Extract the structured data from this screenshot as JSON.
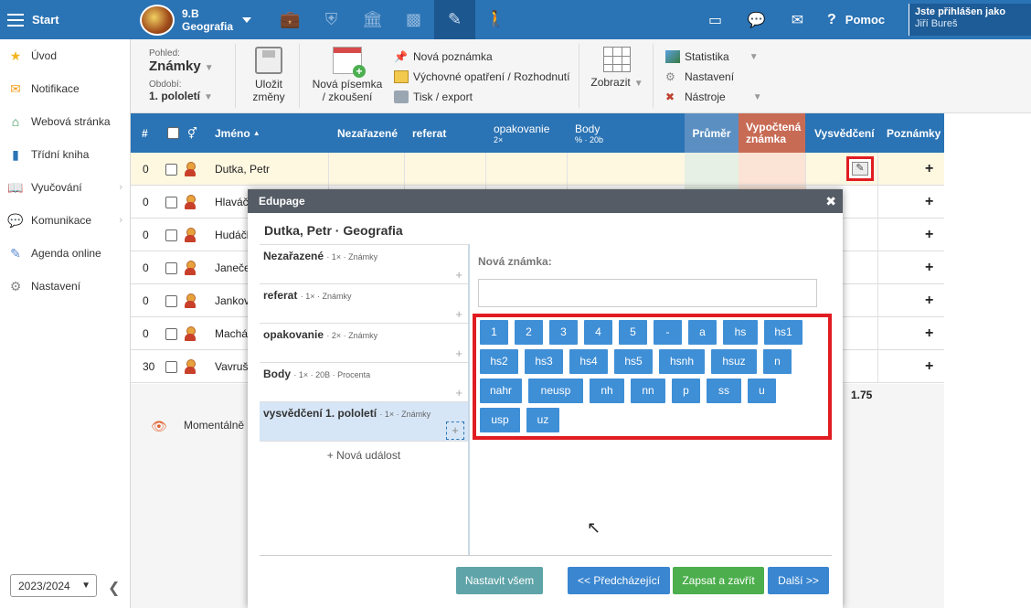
{
  "topbar": {
    "start_label": "Start",
    "class_line1": "9.B",
    "class_line2": "Geografia",
    "help_label": "Pomoc",
    "user_line1": "Jste přihlášen jako",
    "user_line2": "Jiří Bureš"
  },
  "sidebar": {
    "items": [
      {
        "label": "Úvod",
        "icon": "star-icon",
        "color": "#f2b51f"
      },
      {
        "label": "Notifikace",
        "icon": "envelope-icon",
        "color": "#f2a01f"
      },
      {
        "label": "Webová stránka",
        "icon": "home-icon",
        "color": "#2f8f4e"
      },
      {
        "label": "Třídní kniha",
        "icon": "book-icon",
        "color": "#2a73b4"
      },
      {
        "label": "Vyučování",
        "icon": "open-book-icon",
        "color": "#2a73b4"
      },
      {
        "label": "Komunikace",
        "icon": "chat-icon",
        "color": "#d04a2a"
      },
      {
        "label": "Agenda online",
        "icon": "pencil-icon",
        "color": "#5a8ad0"
      },
      {
        "label": "Nastavení",
        "icon": "gear-icon",
        "color": "#888888"
      }
    ],
    "year": "2023/2024"
  },
  "toolbar": {
    "view_label": "Pohled:",
    "view_value": "Známky",
    "period_label": "Období:",
    "period_value": "1. pololetí",
    "save_line1": "Uložit",
    "save_line2": "změny",
    "new_exam_line1": "Nová písemka",
    "new_exam_line2": "/ zkoušení",
    "list1": [
      "Nová poznámka",
      "Výchovné opatření / Rozhodnutí",
      "Tisk / export"
    ],
    "show_label": "Zobrazit",
    "list2": [
      "Statistika",
      "Nastavení",
      "Nástroje"
    ]
  },
  "table": {
    "headers": {
      "num": "#",
      "name": "Jméno",
      "nezarazene": "Nezařazené",
      "referat": "referat",
      "opakovanie": "opakovanie",
      "opakovanie_sub": "2×",
      "body": "Body",
      "body_sub": "% · 20b",
      "prumer": "Průměr",
      "vyp1": "Vypočtená",
      "vyp2": "známka",
      "vysvedceni": "Vysvědčení",
      "poznamky": "Poznámky"
    },
    "rows": [
      {
        "num": "0",
        "name": "Dutka, Petr"
      },
      {
        "num": "0",
        "name": "Hlaváč"
      },
      {
        "num": "0",
        "name": "Hudáčl"
      },
      {
        "num": "0",
        "name": "Janeče"
      },
      {
        "num": "0",
        "name": "Jankov"
      },
      {
        "num": "0",
        "name": "Machá"
      },
      {
        "num": "30",
        "name": "Vavruš"
      }
    ],
    "plus": "+",
    "average": "1.75",
    "momentalne": "Momentálně"
  },
  "dialog": {
    "header": "Edupage",
    "title": "Dutka, Petr · Geografia",
    "events": [
      {
        "name": "Nezařazené",
        "meta": "· 1× · Známky"
      },
      {
        "name": "referat",
        "meta": "· 1× · Známky"
      },
      {
        "name": "opakovanie",
        "meta": "· 2× · Známky"
      },
      {
        "name": "Body",
        "meta": "· 1× · 20B · Procenta"
      },
      {
        "name": "vysvědčení 1. pololetí",
        "meta": "· 1× · Známky"
      }
    ],
    "new_event": "+ Nová událost",
    "new_grade_label": "Nová známka:",
    "grades": [
      "1",
      "2",
      "3",
      "4",
      "5",
      "-",
      "a",
      "hs",
      "hs1",
      "hs2",
      "hs3",
      "hs4",
      "hs5",
      "hsnh",
      "hsuz",
      "n",
      "nahr",
      "neusp",
      "nh",
      "nn",
      "p",
      "ss",
      "u",
      "usp",
      "uz"
    ],
    "buttons": {
      "set_all": "Nastavit všem",
      "prev": "<< Předcházející",
      "save_close": "Zapsat a zavřít",
      "next": "Další >>"
    }
  }
}
